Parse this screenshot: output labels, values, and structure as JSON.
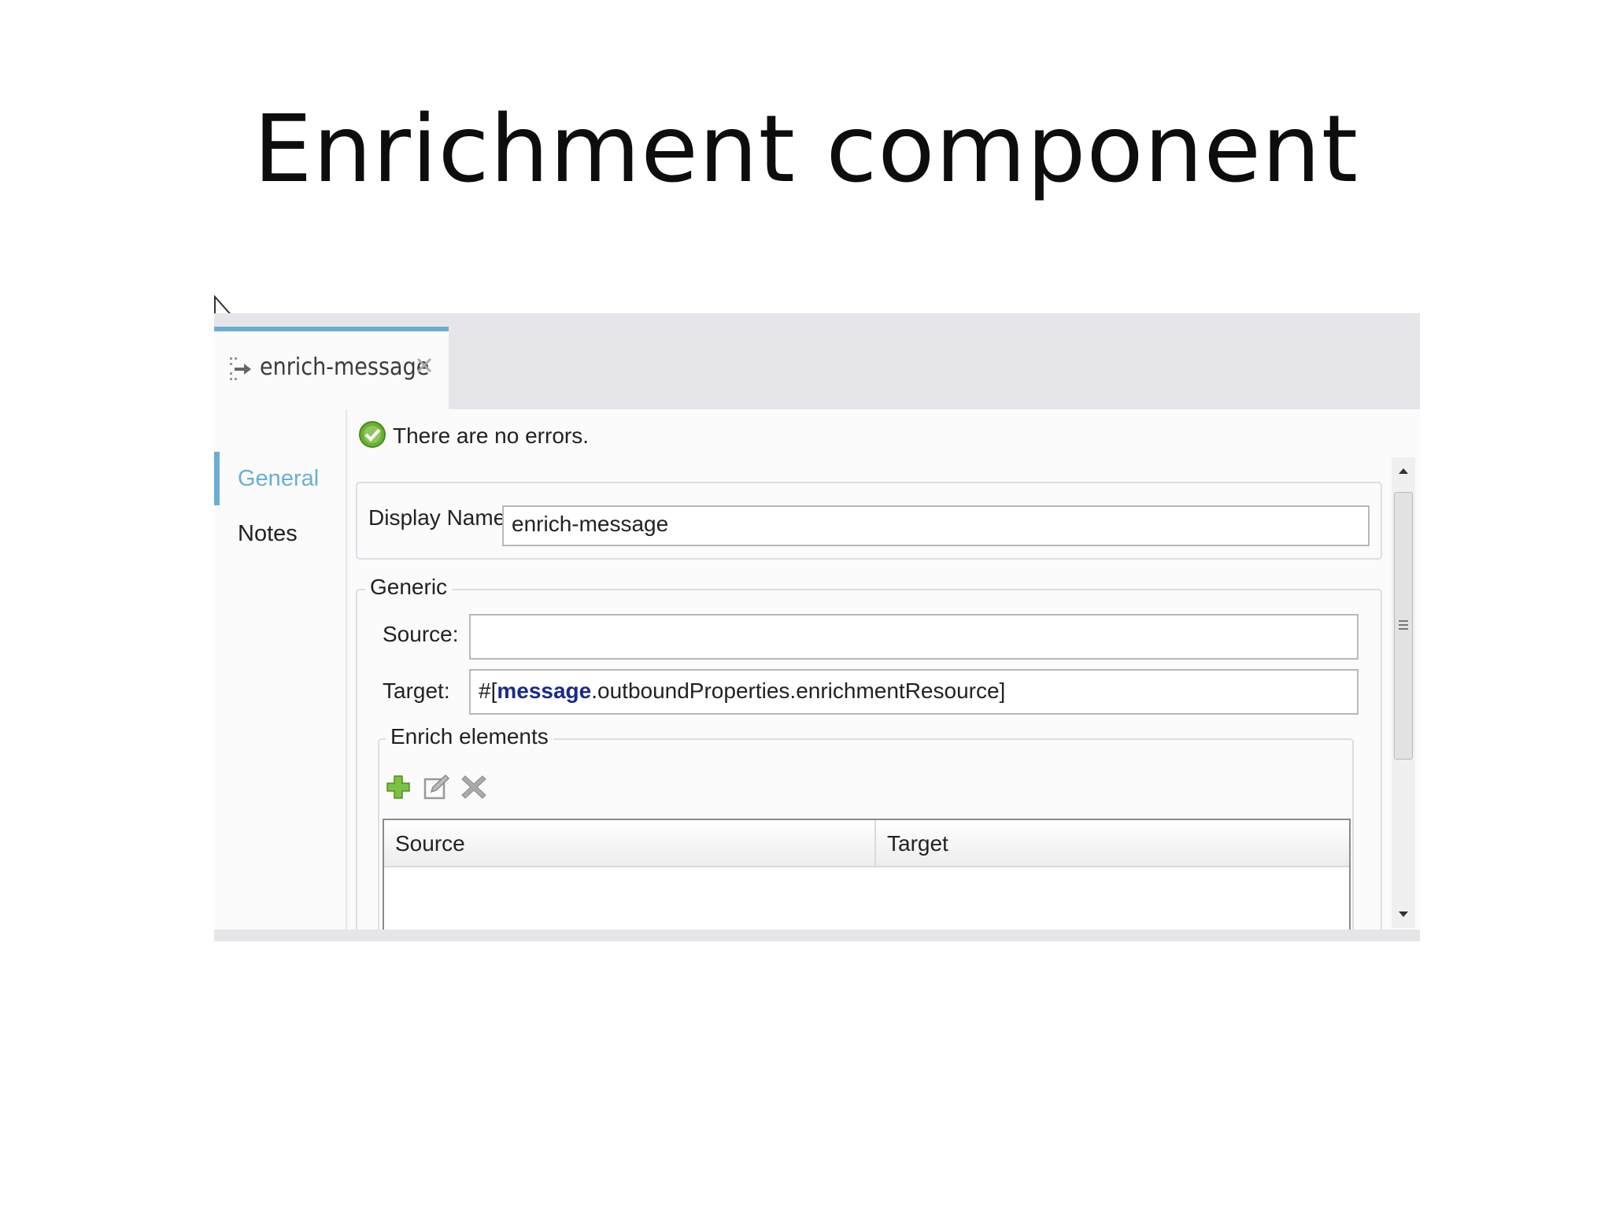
{
  "slide": {
    "title": "Enrichment component"
  },
  "editor": {
    "tab": {
      "label": "enrich-message"
    },
    "nav": {
      "items": [
        {
          "label": "General",
          "active": true
        },
        {
          "label": "Notes",
          "active": false
        }
      ]
    },
    "status": {
      "text": "There are no errors."
    },
    "display_name": {
      "label": "Display Name:",
      "value": "enrich-message"
    },
    "generic": {
      "legend": "Generic",
      "source": {
        "label": "Source:",
        "value": ""
      },
      "target": {
        "label": "Target:",
        "prefix": "#[",
        "keyword": "message",
        "suffix": ".outboundProperties.enrichmentResource]"
      }
    },
    "enrich_elements": {
      "legend": "Enrich elements",
      "toolbar": {
        "icons": [
          "add-icon",
          "edit-icon",
          "delete-icon"
        ]
      },
      "table": {
        "columns": [
          "Source",
          "Target"
        ],
        "rows": []
      }
    }
  },
  "colors": {
    "accent": "#6aaed6",
    "keyword": "#1a2a8a",
    "success": "#6ab22e"
  }
}
